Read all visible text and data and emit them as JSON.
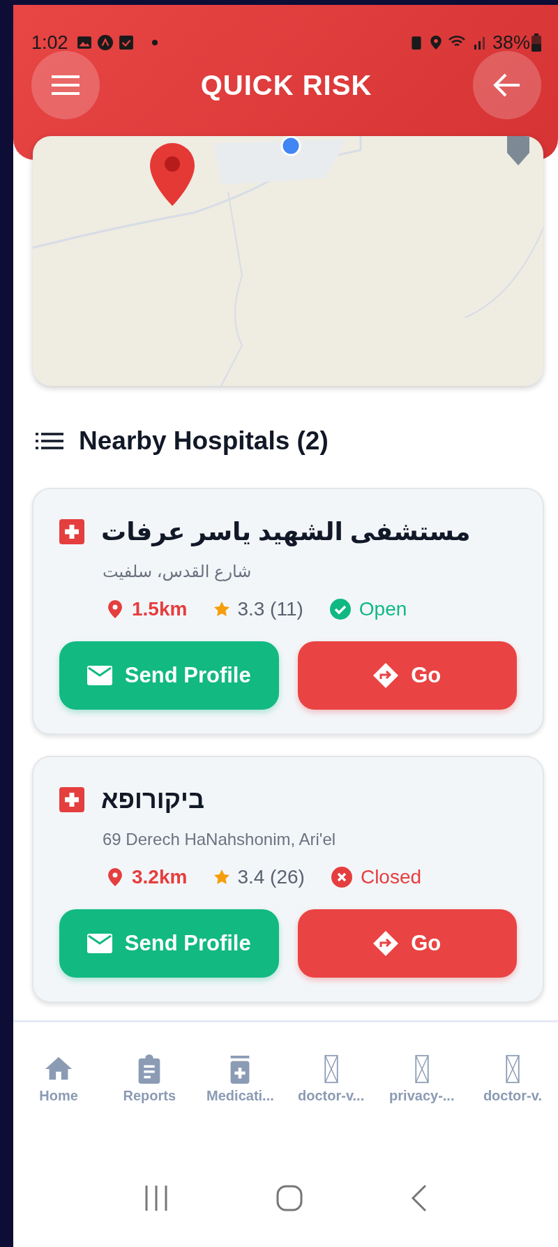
{
  "status_bar": {
    "time": "1:02",
    "battery": "38%"
  },
  "header": {
    "title": "QUICK RISK"
  },
  "section": {
    "title": "Nearby Hospitals (2)"
  },
  "hospitals": [
    {
      "name": "مستشفى الشهيد ياسر عرفات",
      "address": "شارع القدس، سلفيت",
      "distance": "1.5km",
      "rating": "3.3 (11)",
      "status": "Open",
      "open": true,
      "actions": [
        "Send Profile",
        "Go"
      ]
    },
    {
      "name": "ביקורופא",
      "address": "69 Derech HaNahshonim, Ari'el",
      "distance": "3.2km",
      "rating": "3.4 (26)",
      "status": "Closed",
      "open": false,
      "actions": [
        "Send Profile",
        "Go"
      ]
    }
  ],
  "bottom_nav": [
    {
      "label": "Home",
      "kind": "home"
    },
    {
      "label": "Reports",
      "kind": "reports"
    },
    {
      "label": "Medicati...",
      "kind": "medication"
    },
    {
      "label": "doctor-v...",
      "kind": "broken"
    },
    {
      "label": "privacy-...",
      "kind": "broken"
    },
    {
      "label": "doctor-v.",
      "kind": "broken"
    }
  ]
}
